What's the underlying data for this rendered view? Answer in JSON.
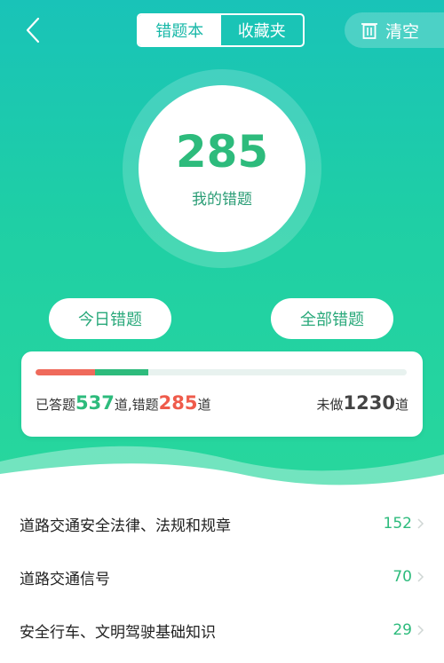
{
  "header": {
    "tabs": [
      {
        "label": "错题本",
        "active": true
      },
      {
        "label": "收藏夹",
        "active": false
      }
    ],
    "clear_label": "清空"
  },
  "summary": {
    "count": "285",
    "label": "我的错题"
  },
  "actions": {
    "today_label": "今日错题",
    "all_label": "全部错题"
  },
  "progress": {
    "wrong_fraction": 0.16,
    "correct_fraction": 0.145,
    "answered_prefix": "已答题",
    "answered": "537",
    "answered_unit": "道,错题",
    "wrong": "285",
    "wrong_unit": "道",
    "undone_prefix": "未做",
    "undone": "1230",
    "undone_unit": "道"
  },
  "categories": [
    {
      "title": "道路交通安全法律、法规和规章",
      "count": "152"
    },
    {
      "title": "道路交通信号",
      "count": "70"
    },
    {
      "title": "安全行车、文明驾驶基础知识",
      "count": "29"
    }
  ],
  "colors": {
    "accent": "#2dbb7c",
    "wrong": "#ef5b4b",
    "gradient_top": "#19c3b8",
    "gradient_bottom": "#28d79c"
  },
  "icons": {
    "back": "chevron-left-icon",
    "clear": "trash-icon",
    "row": "chevron-right-icon"
  }
}
